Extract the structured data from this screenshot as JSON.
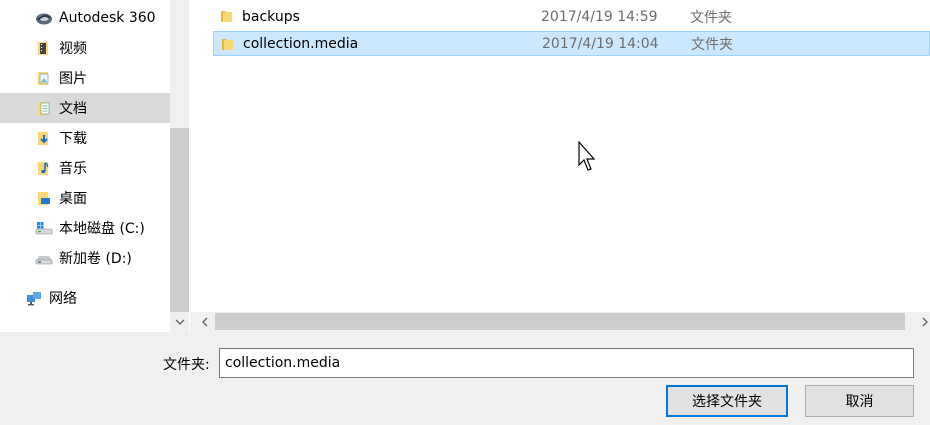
{
  "sidebar": {
    "items": [
      {
        "label": "Autodesk 360",
        "icon": "autodesk-cloud-icon"
      },
      {
        "label": "视频",
        "icon": "video-folder-icon"
      },
      {
        "label": "图片",
        "icon": "pictures-folder-icon"
      },
      {
        "label": "文档",
        "icon": "documents-folder-icon",
        "selected": true
      },
      {
        "label": "下载",
        "icon": "downloads-folder-icon"
      },
      {
        "label": "音乐",
        "icon": "music-folder-icon"
      },
      {
        "label": "桌面",
        "icon": "desktop-folder-icon"
      },
      {
        "label": "本地磁盘 (C:)",
        "icon": "system-drive-icon"
      },
      {
        "label": "新加卷 (D:)",
        "icon": "drive-icon"
      },
      {
        "label": "网络",
        "icon": "network-icon"
      }
    ]
  },
  "files": [
    {
      "name": "backups",
      "date": "2017/4/19 14:59",
      "type": "文件夹"
    },
    {
      "name": "collection.media",
      "date": "2017/4/19 14:04",
      "type": "文件夹",
      "selected": true
    }
  ],
  "footer": {
    "folder_label": "文件夹:",
    "folder_value": "collection.media",
    "select_button": "选择文件夹",
    "cancel_button": "取消"
  },
  "colors": {
    "selection_bg": "#cce8ff",
    "selection_border": "#99d1ff",
    "sidebar_selected": "#d9d9d9",
    "primary_border": "#0078d7",
    "folder_yellow": "#f8d775"
  }
}
